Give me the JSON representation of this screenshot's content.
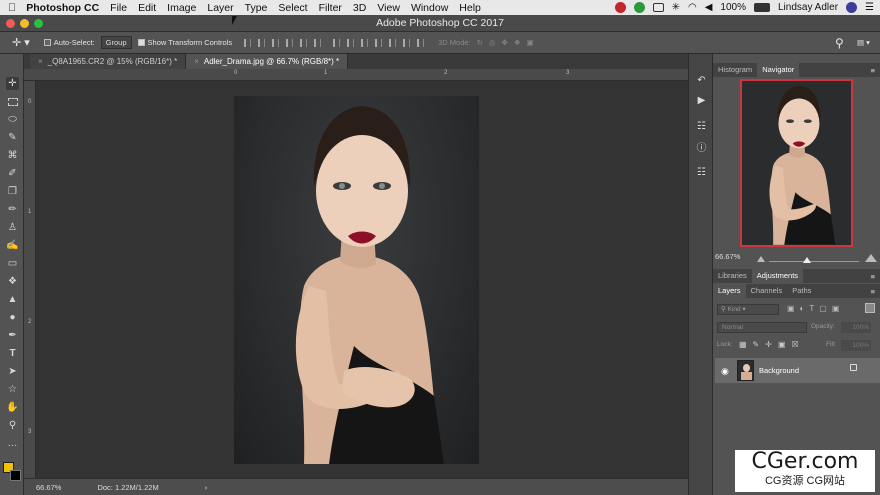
{
  "menubar": {
    "app_name": "Photoshop CC",
    "items": [
      "File",
      "Edit",
      "Image",
      "Layer",
      "Type",
      "Select",
      "Filter",
      "3D",
      "View",
      "Window",
      "Help"
    ],
    "battery": "100%",
    "user": "Lindsay Adler"
  },
  "window": {
    "title": "Adobe Photoshop CC 2017"
  },
  "options": {
    "auto_select_label": "Auto-Select:",
    "auto_select_value": "Group",
    "show_transform_label": "Show Transform Controls",
    "mode_3d_label": "3D Mode:"
  },
  "tabs": [
    {
      "label": "_Q8A1965.CR2 @ 15% (RGB/16*) *"
    },
    {
      "label": "Adler_Drama.jpg @ 66.7% (RGB/8*) *"
    }
  ],
  "ruler": {
    "top": [
      "0",
      "1",
      "2",
      "3"
    ],
    "left": [
      "0",
      "1",
      "2",
      "3"
    ]
  },
  "status": {
    "zoom": "66.67%",
    "doc": "Doc: 1.22M/1.22M",
    "arrow": "›"
  },
  "panels": {
    "top_tabs": [
      "Histogram",
      "Navigator"
    ],
    "nav_zoom": "66.67%",
    "mid_tabs": [
      "Libraries",
      "Adjustments"
    ],
    "layer_tabs": [
      "Layers",
      "Channels",
      "Paths"
    ],
    "kind_placeholder": "Kind",
    "blend_mode": "Normal",
    "opacity_label": "Opacity:",
    "opacity_value": "100%",
    "lock_label": "Lock:",
    "fill_label": "Fill:",
    "fill_value": "100%",
    "layer_name": "Background"
  },
  "watermark": {
    "main": "CGer.com",
    "sub": "CG资源 CG网站"
  },
  "colors": {
    "accent_red": "#d0343c",
    "foreground": "#f2c200",
    "background": "#000000"
  }
}
